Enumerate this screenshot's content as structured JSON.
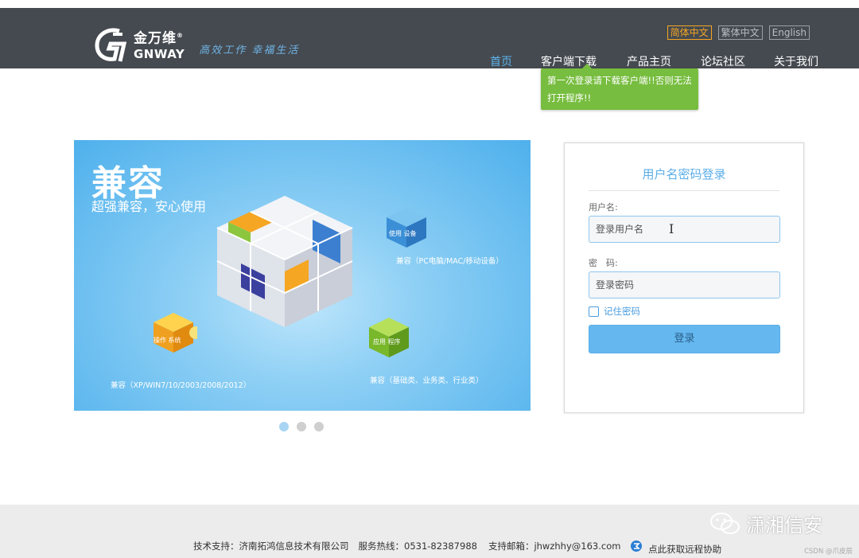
{
  "header": {
    "logo_cn": "金万维",
    "logo_en": "GNWAY",
    "logo_reg": "®",
    "slogan": "高效工作 幸福生活",
    "languages": [
      "简体中文",
      "繁体中文",
      "English"
    ],
    "nav": [
      "首页",
      "客户端下载",
      "产品主页",
      "论坛社区",
      "关于我们"
    ]
  },
  "tooltip": {
    "text_line1": "第一次登录请下载客户端!!否则无法",
    "text_line2": "打开程序!!"
  },
  "banner": {
    "title": "兼容",
    "subtitle": "超强兼容，安心使用",
    "cube1_label": "使用 设备",
    "cap1": "兼容（PC电脑/MAC/移动设备）",
    "cube2_label": "操作 系统",
    "cap2": "兼容（XP/WIN7/10/2003/2008/2012）",
    "cube3_label": "应用 程序",
    "cap3": "兼容（基础类、业务类、行业类）"
  },
  "login": {
    "title": "用户名密码登录",
    "username_label": "用户名:",
    "username_placeholder": "登录用户名",
    "password_label": "密　码:",
    "password_placeholder": "登录密码",
    "remember_label": "记住密码",
    "submit_label": "登录"
  },
  "footer": {
    "support": "技术支持：济南拓鸿信息技术有限公司",
    "hotline": "服务热线：0531-82387988",
    "email": "支持邮箱：jhwzhhy@163.com",
    "remote": "点此获取远程协助"
  },
  "watermark": "潇湘信安",
  "csdn": "CSDN @爪皮辰",
  "colors": {
    "header_bg": "#454a50",
    "accent": "#5bb4ec",
    "tooltip_bg": "#77bd3f",
    "lang_active": "#f5a623"
  }
}
